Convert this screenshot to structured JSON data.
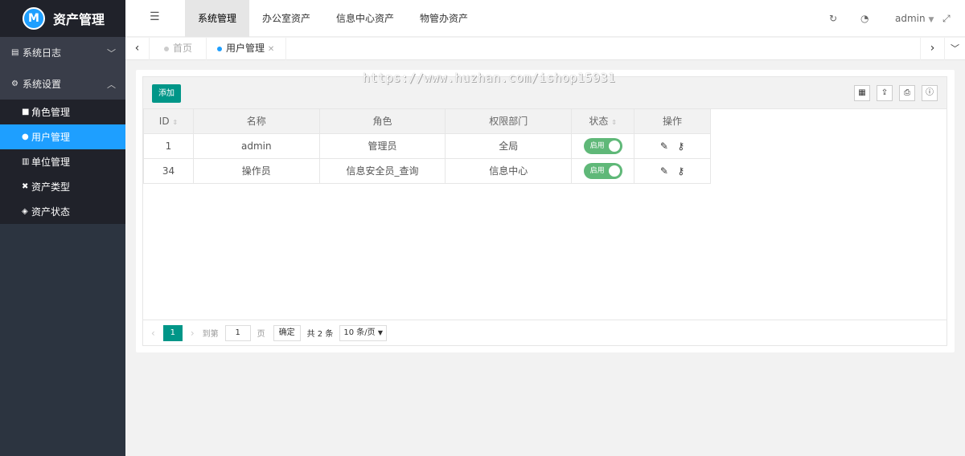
{
  "app": {
    "title": "资产管理",
    "logo_mark": "M"
  },
  "sidebar": {
    "groups": [
      {
        "label": "系统日志",
        "icon": "file-icon",
        "expanded": false
      },
      {
        "label": "系统设置",
        "icon": "gears-icon",
        "expanded": true,
        "items": [
          {
            "label": "角色管理",
            "icon": "lock-icon"
          },
          {
            "label": "用户管理",
            "icon": "user-icon",
            "active": true
          },
          {
            "label": "单位管理",
            "icon": "bank-icon"
          },
          {
            "label": "资产类型",
            "icon": "cross-icon"
          },
          {
            "label": "资产状态",
            "icon": "cube-icon"
          }
        ]
      }
    ]
  },
  "header": {
    "menus": [
      {
        "label": "系统管理",
        "active": true
      },
      {
        "label": "办公室资产"
      },
      {
        "label": "信息中心资产"
      },
      {
        "label": "物管办资产"
      }
    ],
    "user": "admin"
  },
  "tabs": [
    {
      "label": "首页"
    },
    {
      "label": "用户管理",
      "active": true
    }
  ],
  "watermark": "https://www.huzhan.com/ishop15931",
  "table": {
    "add_label": "添加",
    "columns": [
      "ID",
      "名称",
      "角色",
      "权限部门",
      "状态",
      "操作"
    ],
    "rows": [
      {
        "id": "1",
        "name": "admin",
        "role": "管理员",
        "dept": "全局",
        "status": "启用"
      },
      {
        "id": "34",
        "name": "操作员",
        "role": "信息安全员_查询",
        "dept": "信息中心",
        "status": "启用"
      }
    ]
  },
  "pager": {
    "current": "1",
    "goto_prefix": "到第",
    "goto_value": "1",
    "goto_suffix": "页",
    "confirm": "确定",
    "total": "共 2 条",
    "page_size": "10 条/页"
  }
}
